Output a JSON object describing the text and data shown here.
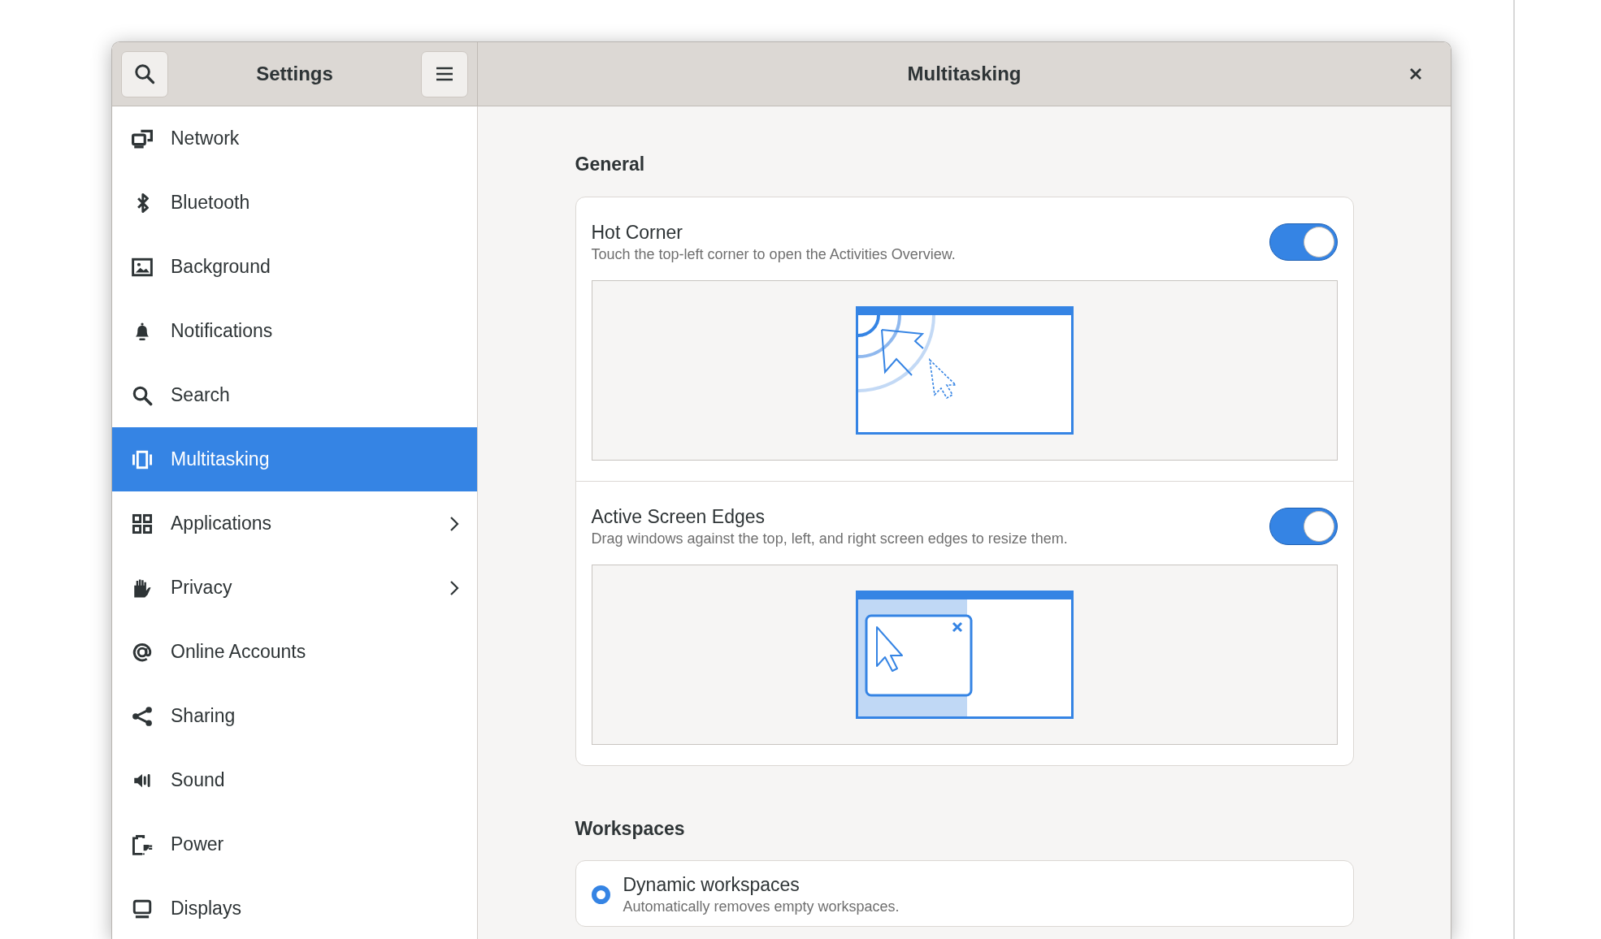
{
  "header": {
    "sidebar_title": "Settings",
    "page_title": "Multitasking"
  },
  "sidebar": {
    "groups": [
      [
        {
          "label": "Network",
          "selected": false,
          "arrow": false
        },
        {
          "label": "Bluetooth",
          "selected": false,
          "arrow": false
        }
      ],
      [
        {
          "label": "Background",
          "selected": false,
          "arrow": false
        },
        {
          "label": "Notifications",
          "selected": false,
          "arrow": false
        },
        {
          "label": "Search",
          "selected": false,
          "arrow": false
        },
        {
          "label": "Multitasking",
          "selected": true,
          "arrow": false
        },
        {
          "label": "Applications",
          "selected": false,
          "arrow": true
        },
        {
          "label": "Privacy",
          "selected": false,
          "arrow": true
        },
        {
          "label": "Online Accounts",
          "selected": false,
          "arrow": false
        },
        {
          "label": "Sharing",
          "selected": false,
          "arrow": false
        }
      ],
      [
        {
          "label": "Sound",
          "selected": false,
          "arrow": false
        },
        {
          "label": "Power",
          "selected": false,
          "arrow": false
        },
        {
          "label": "Displays",
          "selected": false,
          "arrow": false
        }
      ]
    ]
  },
  "sections": [
    {
      "heading": "General",
      "rows": [
        {
          "kind": "toggle",
          "title": "Hot Corner",
          "description": "Touch the top-left corner to open the Activities Overview.",
          "on": true
        },
        {
          "kind": "toggle",
          "title": "Active Screen Edges",
          "description": "Drag windows against the top, left, and right screen edges to resize them.",
          "on": true
        }
      ]
    },
    {
      "heading": "Workspaces",
      "rows": [
        {
          "kind": "radio",
          "title": "Dynamic workspaces",
          "description": "Automatically removes empty workspaces.",
          "selected": true
        }
      ]
    }
  ]
}
